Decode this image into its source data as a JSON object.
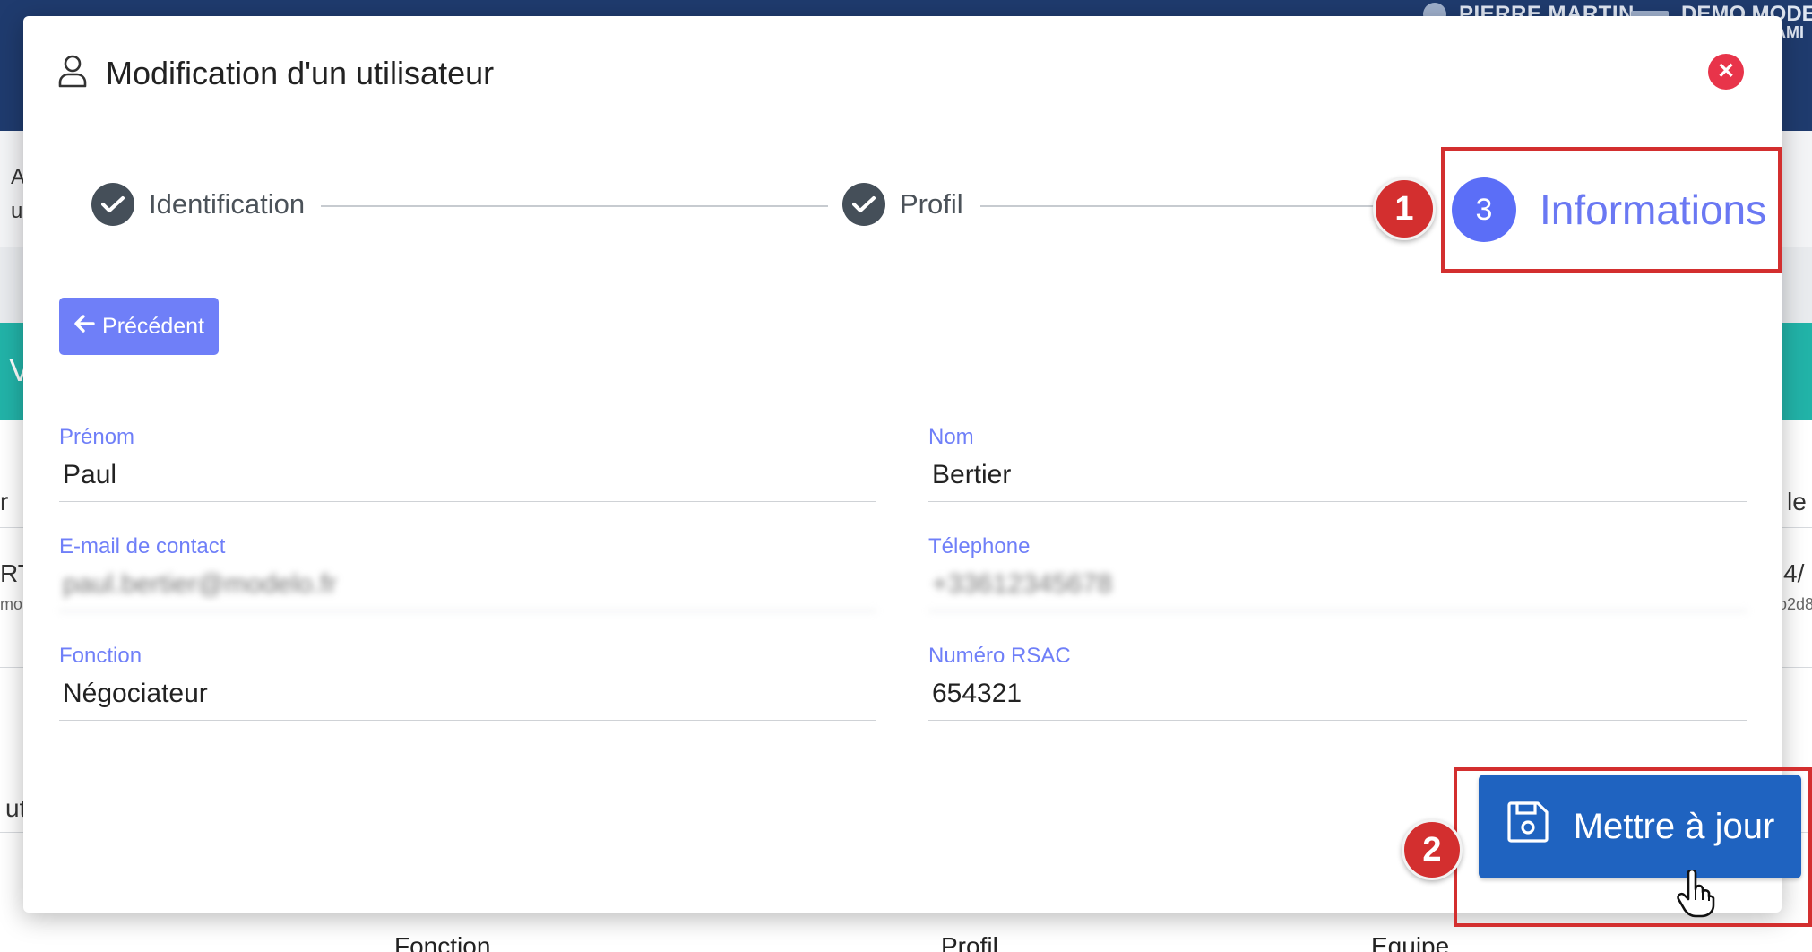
{
  "background": {
    "user_name": "PIERRE MARTIN",
    "demo_label": "DEMO MODE",
    "sub_label": "AMI",
    "table_headers": [
      "Fonction",
      "Profil",
      "Equipe"
    ],
    "fragments": [
      "A",
      "u",
      "r",
      "RT",
      "mo",
      "ut",
      "le",
      "4/",
      "o2d8",
      "V"
    ]
  },
  "modal": {
    "title": "Modification d'un utilisateur",
    "close_symbol": "✕",
    "steps": [
      {
        "label": "Identification",
        "state": "done"
      },
      {
        "label": "Profil",
        "state": "done"
      },
      {
        "number": "3",
        "label": "Informations",
        "state": "active"
      }
    ],
    "annotations": {
      "badge1": "1",
      "badge2": "2"
    },
    "prev_button": "Précédent",
    "fields": {
      "prenom": {
        "label": "Prénom",
        "value": "Paul"
      },
      "nom": {
        "label": "Nom",
        "value": "Bertier"
      },
      "email": {
        "label": "E-mail de contact",
        "value": "paul.bertier@modelo.fr"
      },
      "telephone": {
        "label": "Télephone",
        "value": "+33612345678"
      },
      "fonction": {
        "label": "Fonction",
        "value": "Négociateur"
      },
      "rsac": {
        "label": "Numéro RSAC",
        "value": "654321"
      }
    },
    "submit_button": "Mettre à jour"
  },
  "colors": {
    "accent": "#6f7ff8",
    "step_active": "#5b6ef7",
    "submit": "#1f63c0",
    "annotation": "#d32f2f",
    "close": "#e8344a"
  }
}
